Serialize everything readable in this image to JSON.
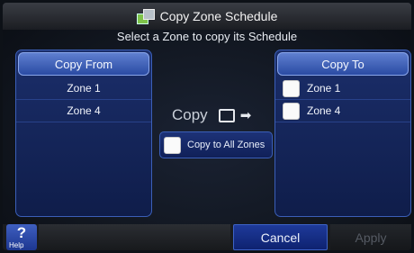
{
  "header": {
    "title": "Copy Zone Schedule",
    "title_icon": "copy-schedule-icon",
    "subtitle": "Select a Zone to copy its Schedule"
  },
  "copy_from": {
    "label": "Copy From",
    "zones": [
      "Zone 1",
      "Zone 4"
    ]
  },
  "copy_to": {
    "label": "Copy To",
    "zones": [
      "Zone 1",
      "Zone 4"
    ]
  },
  "center": {
    "copy_label": "Copy",
    "copy_all_label": "Copy to All Zones"
  },
  "footer": {
    "help_label": "Help",
    "help_glyph": "?",
    "cancel_label": "Cancel",
    "apply_label": "Apply"
  },
  "colors": {
    "accent": "#2a4ba3",
    "panel_bg": "#0f1d4a",
    "disabled_text": "#555a63"
  }
}
